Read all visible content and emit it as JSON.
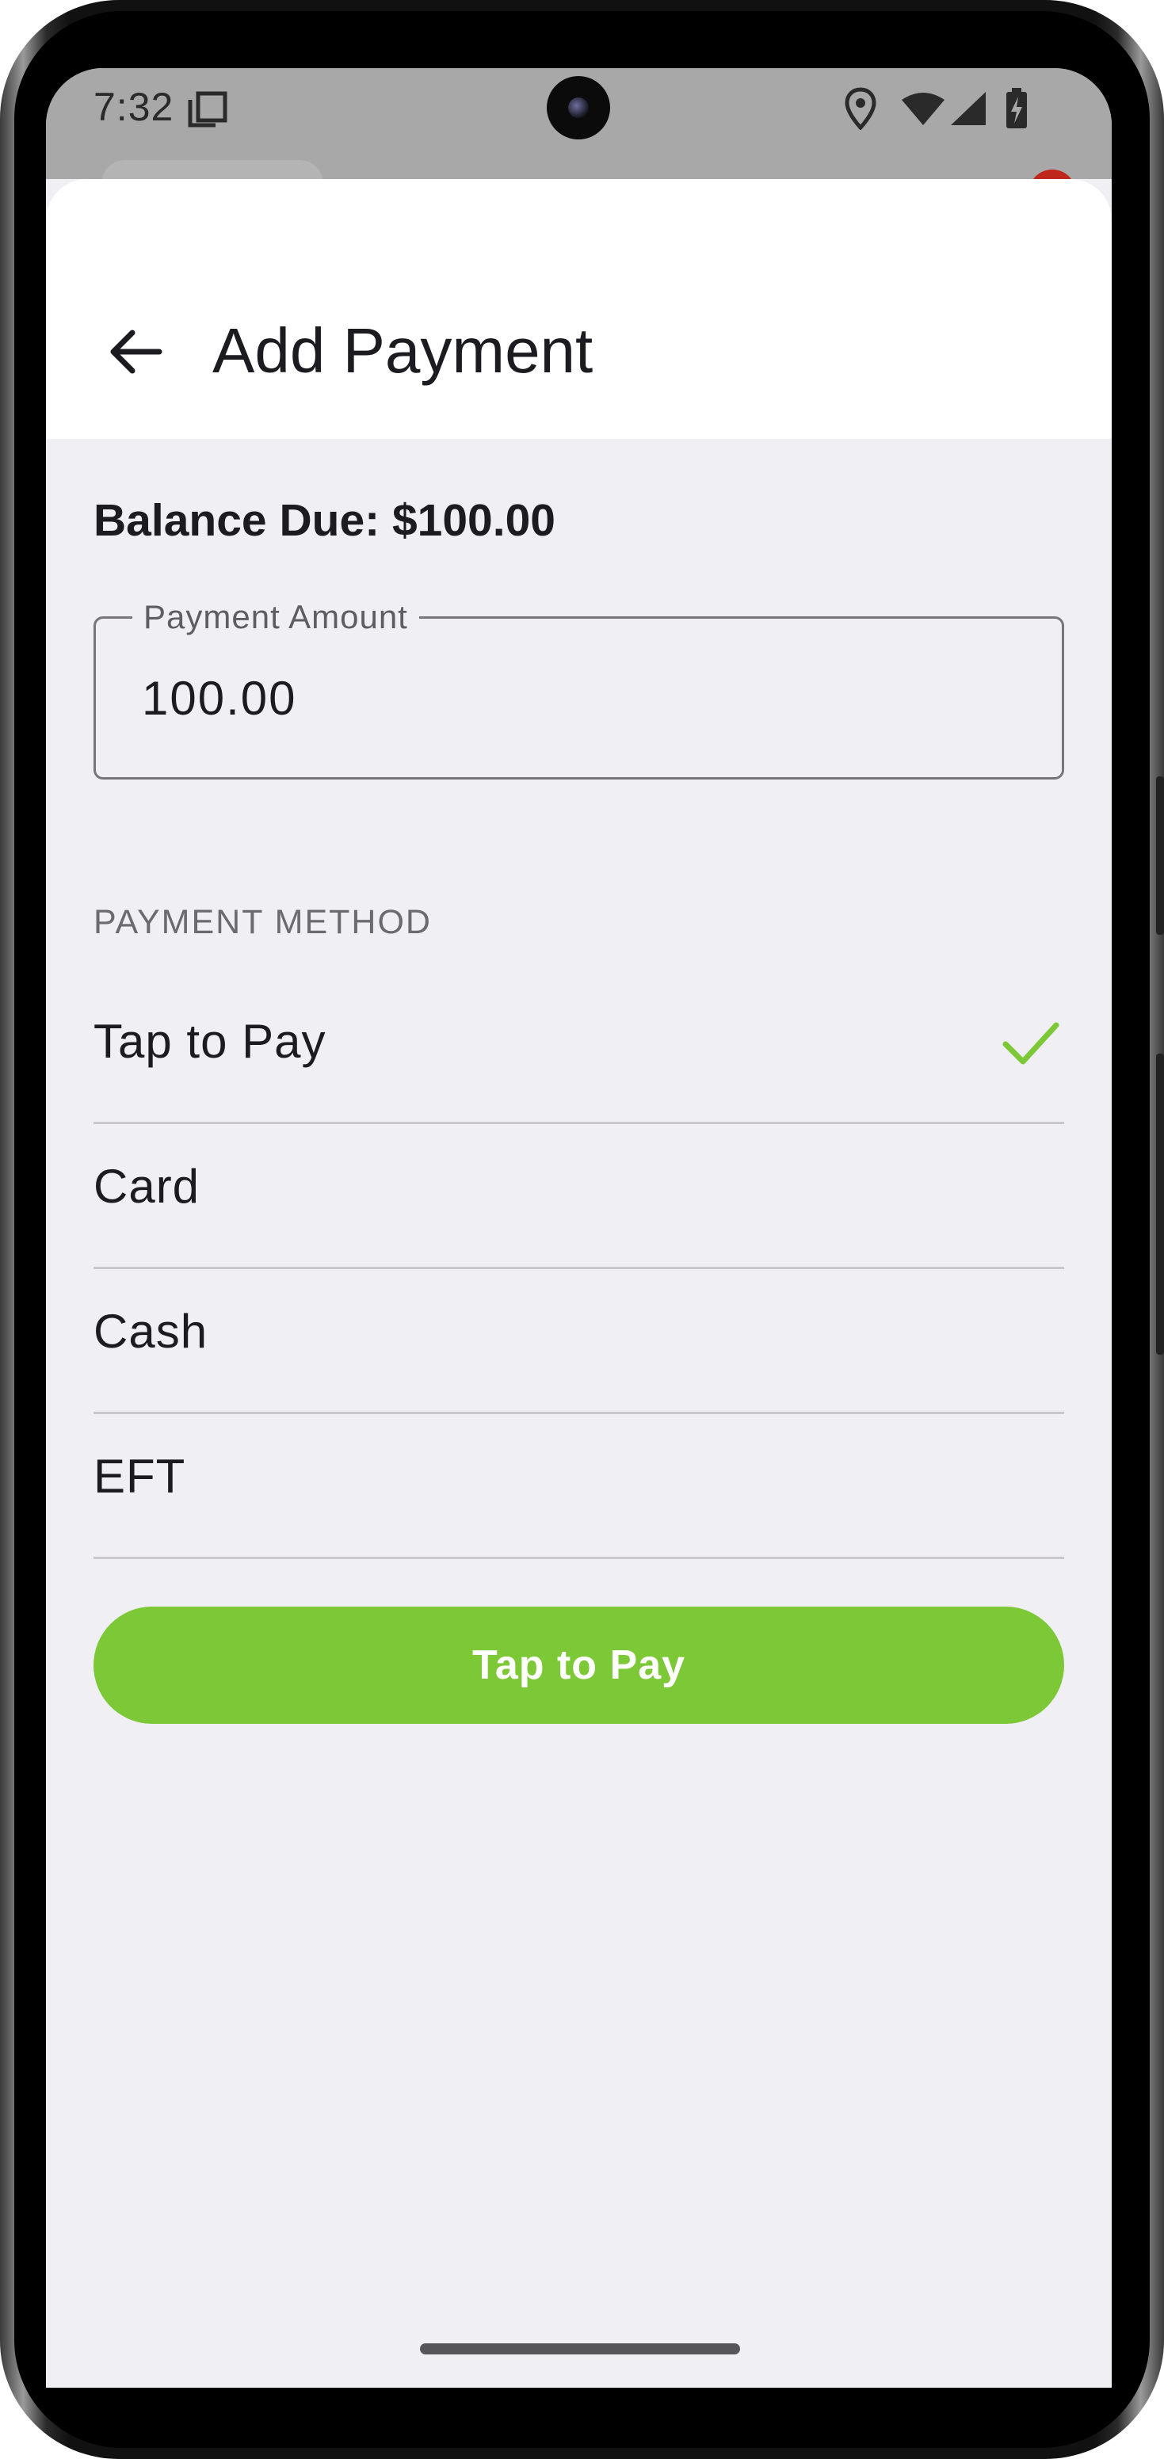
{
  "status_bar": {
    "time": "7:32"
  },
  "header": {
    "title": "Add Payment"
  },
  "balance": {
    "text": "Balance Due: $100.00"
  },
  "payment_amount": {
    "label": "Payment Amount",
    "value": "100.00"
  },
  "payment_method": {
    "section_label": "PAYMENT METHOD",
    "options": [
      {
        "label": "Tap to Pay",
        "selected": true
      },
      {
        "label": "Card",
        "selected": false
      },
      {
        "label": "Cash",
        "selected": false
      },
      {
        "label": "EFT",
        "selected": false
      }
    ]
  },
  "primary_action": {
    "label": "Tap to Pay"
  },
  "colors": {
    "accent": "#7dc836",
    "background": "#f0eff4"
  }
}
